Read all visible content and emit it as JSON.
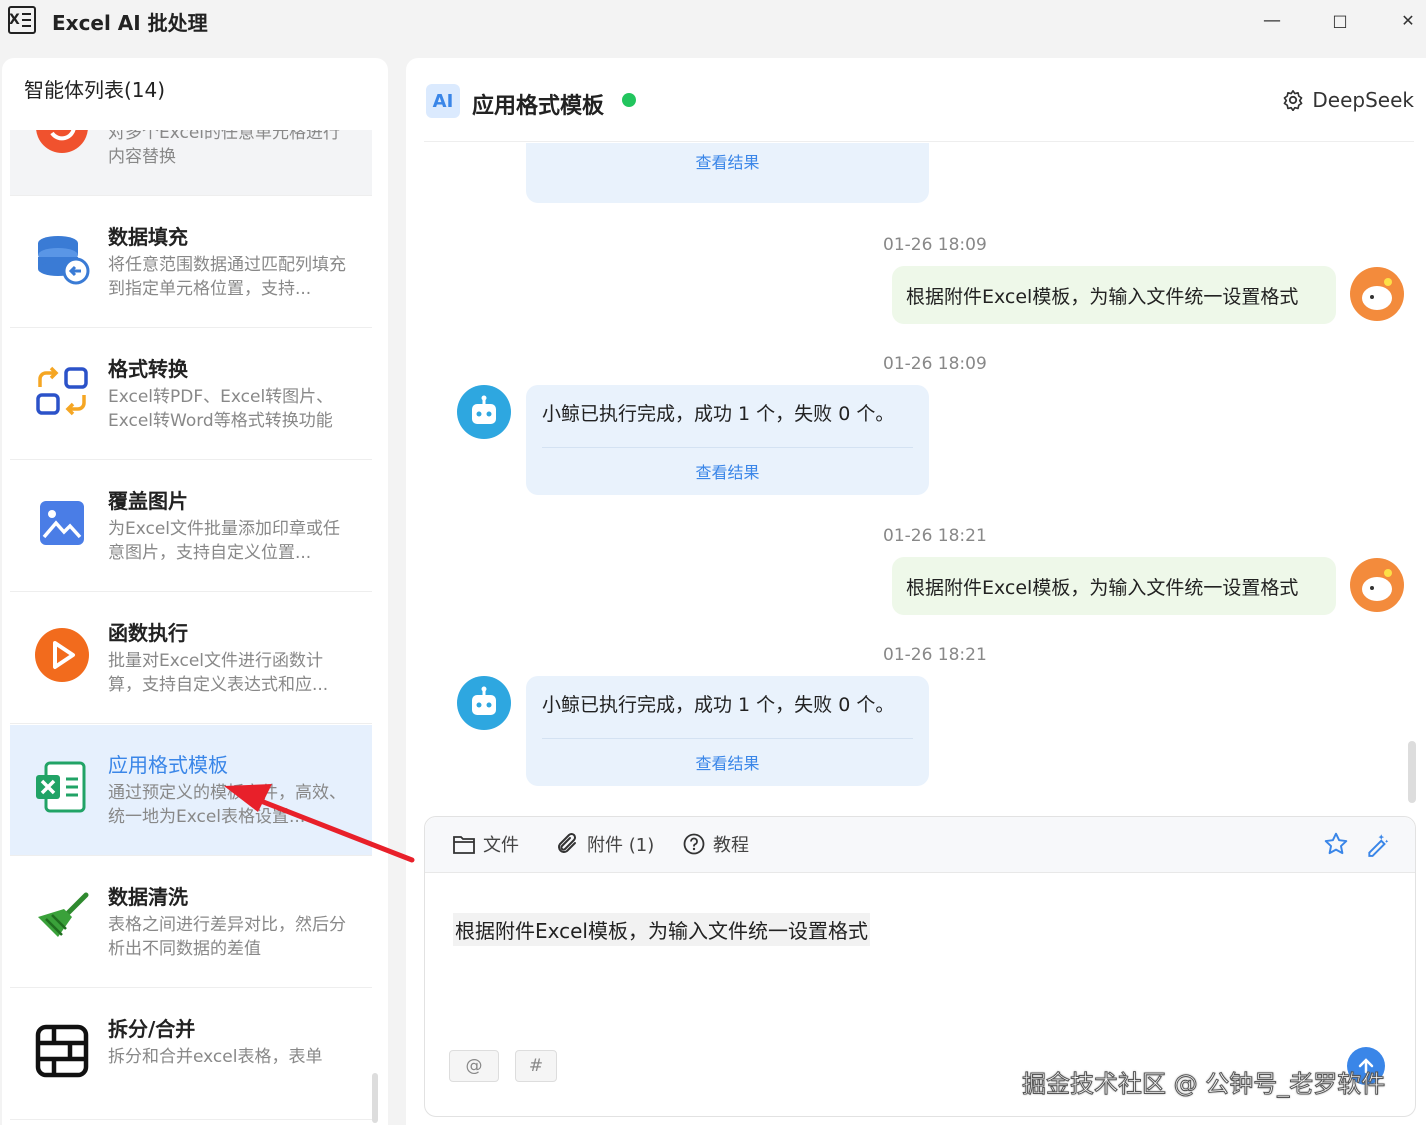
{
  "window": {
    "title": "Excel AI 批处理",
    "minimize": "—",
    "maximize": "□",
    "close": "✕"
  },
  "sidebar": {
    "header": "智能体列表(14)",
    "items": [
      {
        "name": "",
        "desc": "对多个Excel的任意单元格进行内容替换",
        "icon": "replace-icon"
      },
      {
        "name": "数据填充",
        "desc": "将任意范围数据通过匹配列填充到指定单元格位置，支持...",
        "icon": "database-icon"
      },
      {
        "name": "格式转换",
        "desc": "Excel转PDF、Excel转图片、Excel转Word等格式转换功能",
        "icon": "convert-icon"
      },
      {
        "name": "覆盖图片",
        "desc": "为Excel文件批量添加印章或任意图片，支持自定义位置...",
        "icon": "image-icon"
      },
      {
        "name": "函数执行",
        "desc": "批量对Excel文件进行函数计算，支持自定义表达式和应...",
        "icon": "play-icon"
      },
      {
        "name": "应用格式模板",
        "desc": "通过预定义的模板文件，高效、统一地为Excel表格设置...",
        "icon": "excel-template-icon"
      },
      {
        "name": "数据清洗",
        "desc": "表格之间进行差异对比，然后分析出不同数据的差值",
        "icon": "broom-icon"
      },
      {
        "name": "拆分/合并",
        "desc": "拆分和合并excel表格，表单",
        "icon": "split-merge-icon"
      }
    ]
  },
  "chat": {
    "badge": "AI",
    "title": "应用格式模板",
    "model": "DeepSeek",
    "messages": {
      "top_link": "查看结果",
      "ts1": "01-26 18:09",
      "user1": "根据附件Excel模板，为输入文件统一设置格式",
      "ts2": "01-26 18:09",
      "bot1": "小鲸已执行完成，成功 1 个，失败 0 个。",
      "bot1_link": "查看结果",
      "ts3": "01-26 18:21",
      "user2": "根据附件Excel模板，为输入文件统一设置格式",
      "ts4": "01-26 18:21",
      "bot2": "小鲸已执行完成，成功 1 个，失败 0 个。",
      "bot2_link": "查看结果"
    }
  },
  "composer": {
    "file_label": "文件",
    "attach_label": "附件 (1)",
    "tutorial_label": "教程",
    "text": "根据附件Excel模板，为输入文件统一设置格式",
    "mention": "@",
    "hashtag": "#"
  },
  "watermark": "掘金技术社区 @ 公钟号_老罗软件",
  "colors": {
    "accent": "#3a86e8",
    "status_online": "#22c55e",
    "user_bubble": "#eef8e9",
    "bot_bubble": "#e9f2fc"
  }
}
